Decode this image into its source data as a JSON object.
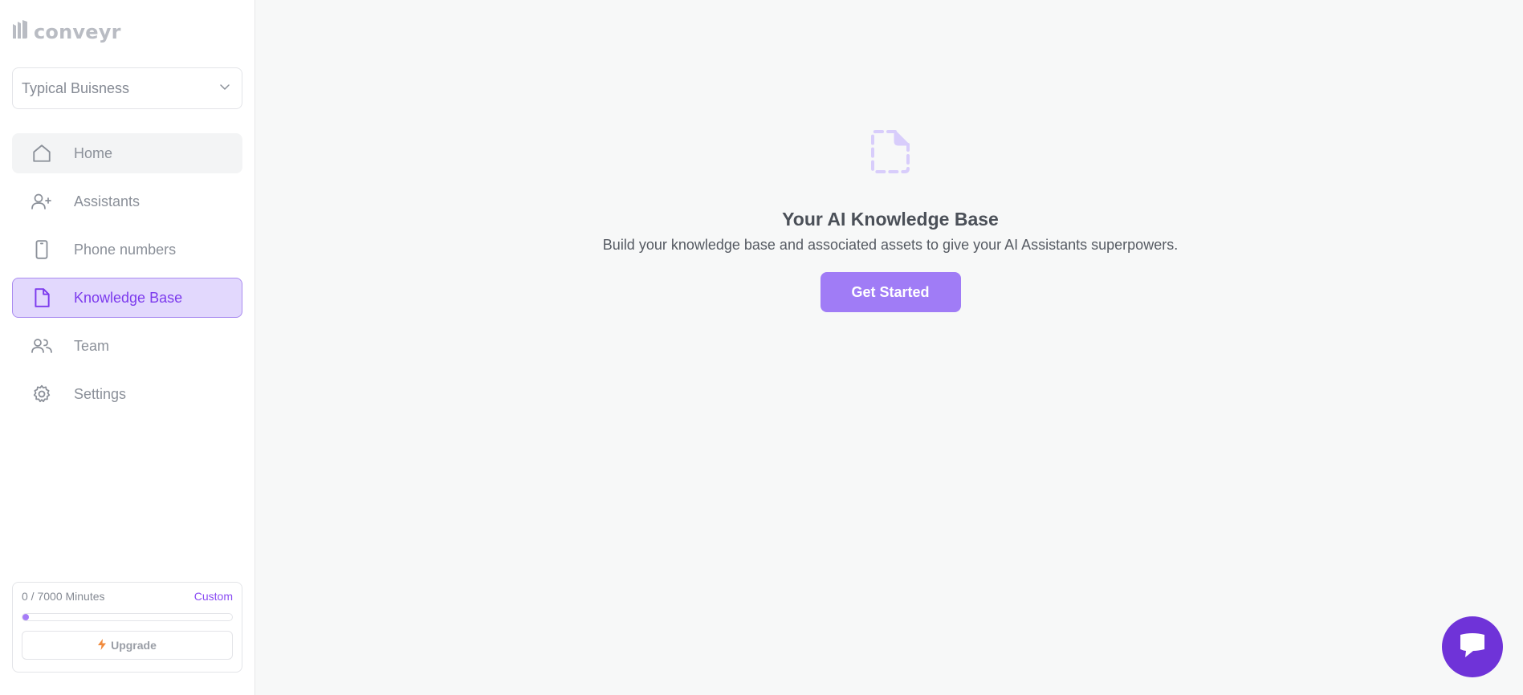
{
  "app": {
    "logo_text": "conveyr"
  },
  "workspace": {
    "selected": "Typical Buisness"
  },
  "nav": {
    "items": [
      {
        "label": "Home",
        "icon": "home-icon"
      },
      {
        "label": "Assistants",
        "icon": "user-plus-icon"
      },
      {
        "label": "Phone numbers",
        "icon": "phone-icon"
      },
      {
        "label": "Knowledge Base",
        "icon": "document-icon"
      },
      {
        "label": "Team",
        "icon": "users-icon"
      },
      {
        "label": "Settings",
        "icon": "gear-icon"
      }
    ],
    "active": "Knowledge Base"
  },
  "usage": {
    "minutes_text": "0 / 7000 Minutes",
    "plan_label": "Custom",
    "progress_fraction": 0.03,
    "upgrade_label": "Upgrade"
  },
  "empty_state": {
    "icon": "document-dashed-icon",
    "title": "Your AI Knowledge Base",
    "description": "Build your knowledge base and associated assets to give your AI Assistants superpowers.",
    "cta_label": "Get Started"
  },
  "chat": {
    "icon": "chat-bubble-icon"
  },
  "colors": {
    "accent": "#7c3aed",
    "button": "#a07cf6",
    "active_bg": "#e2d8fd",
    "chat": "#6f33d8"
  }
}
